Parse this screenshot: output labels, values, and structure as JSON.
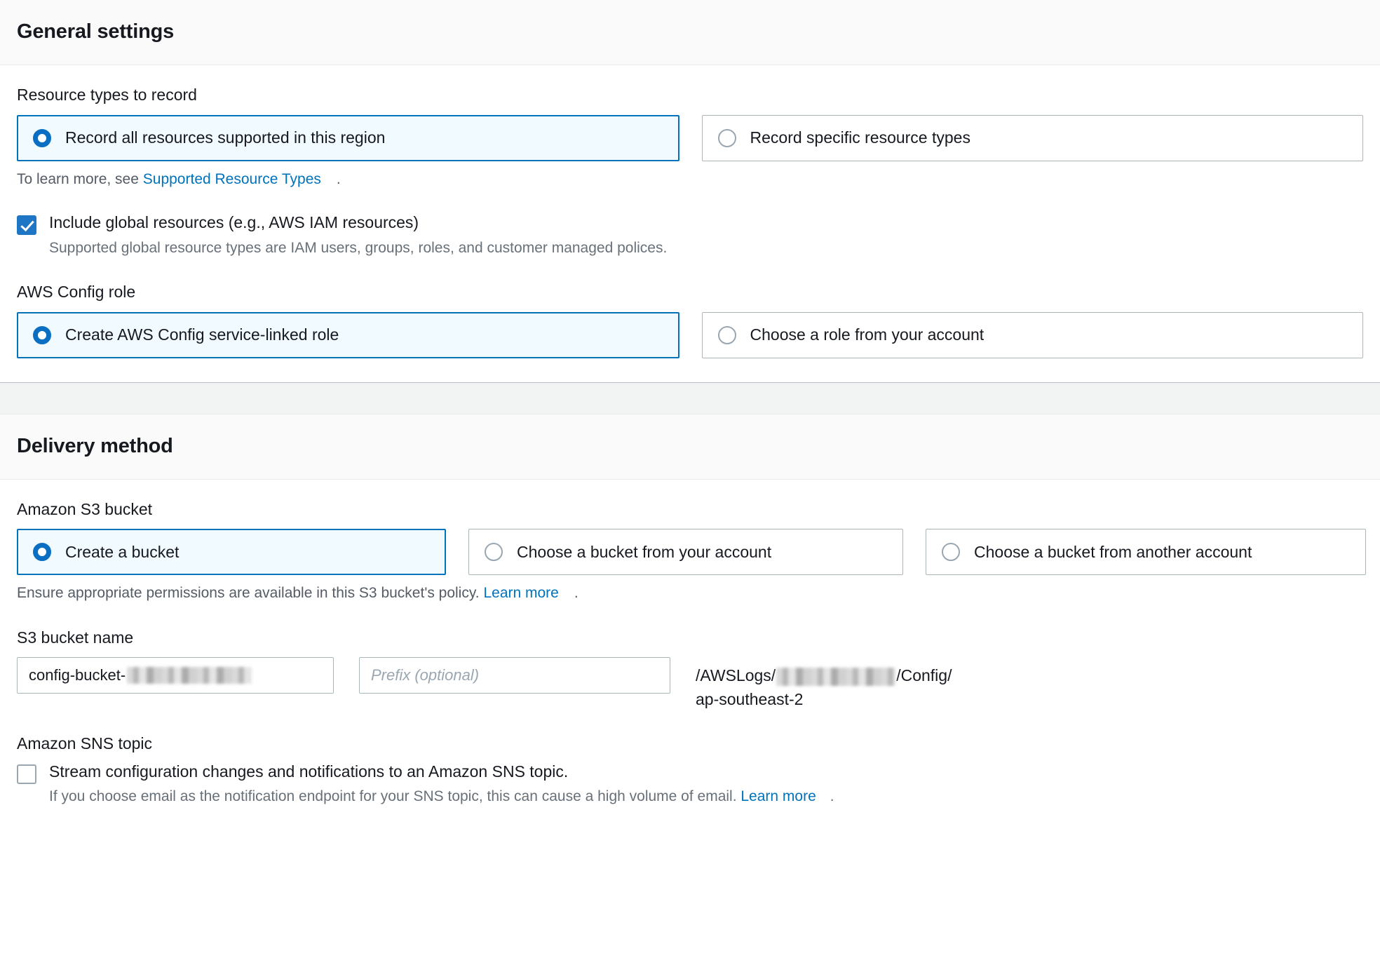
{
  "general_settings": {
    "title": "General settings",
    "resource_types": {
      "label": "Resource types to record",
      "options": [
        {
          "label": "Record all resources supported in this region",
          "selected": true
        },
        {
          "label": "Record specific resource types",
          "selected": false
        }
      ],
      "help_prefix": "To learn more, see ",
      "help_link": "Supported Resource Types",
      "help_suffix": "."
    },
    "global_resources": {
      "label": "Include global resources (e.g., AWS IAM resources)",
      "checked": true,
      "description": "Supported global resource types are IAM users, groups, roles, and customer managed polices."
    },
    "config_role": {
      "label": "AWS Config role",
      "options": [
        {
          "label": "Create AWS Config service-linked role",
          "selected": true
        },
        {
          "label": "Choose a role from your account",
          "selected": false
        }
      ]
    }
  },
  "delivery_method": {
    "title": "Delivery method",
    "s3_bucket": {
      "label": "Amazon S3 bucket",
      "options": [
        {
          "label": "Create a bucket",
          "selected": true
        },
        {
          "label": "Choose a bucket from your account",
          "selected": false
        },
        {
          "label": "Choose a bucket from another account",
          "selected": false
        }
      ],
      "help_prefix": "Ensure appropriate permissions are available in this S3 bucket's policy. ",
      "help_link": "Learn more",
      "help_suffix": "."
    },
    "bucket_name": {
      "label": "S3 bucket name",
      "value": "config-bucket-",
      "value_redacted": true,
      "prefix_placeholder": "Prefix (optional)",
      "prefix_value": "",
      "path_line1_before": "/AWSLogs/",
      "path_line1_after": "/Config/",
      "path_line2": "ap-southeast-2"
    },
    "sns_topic": {
      "label": "Amazon SNS topic",
      "checkbox_label": "Stream configuration changes and notifications to an Amazon SNS topic.",
      "checked": false,
      "description_prefix": "If you choose email as the notification endpoint for your SNS topic, this can cause a high volume of email. ",
      "description_link": "Learn more",
      "description_suffix": "."
    }
  },
  "colors": {
    "accent": "#0073bb",
    "link": "#0073bb",
    "selected_tile_bg": "#f1faff",
    "checkbox_fill": "#1e76c4",
    "header_bg": "#fafafa",
    "gap_bg": "#f2f3f3"
  }
}
